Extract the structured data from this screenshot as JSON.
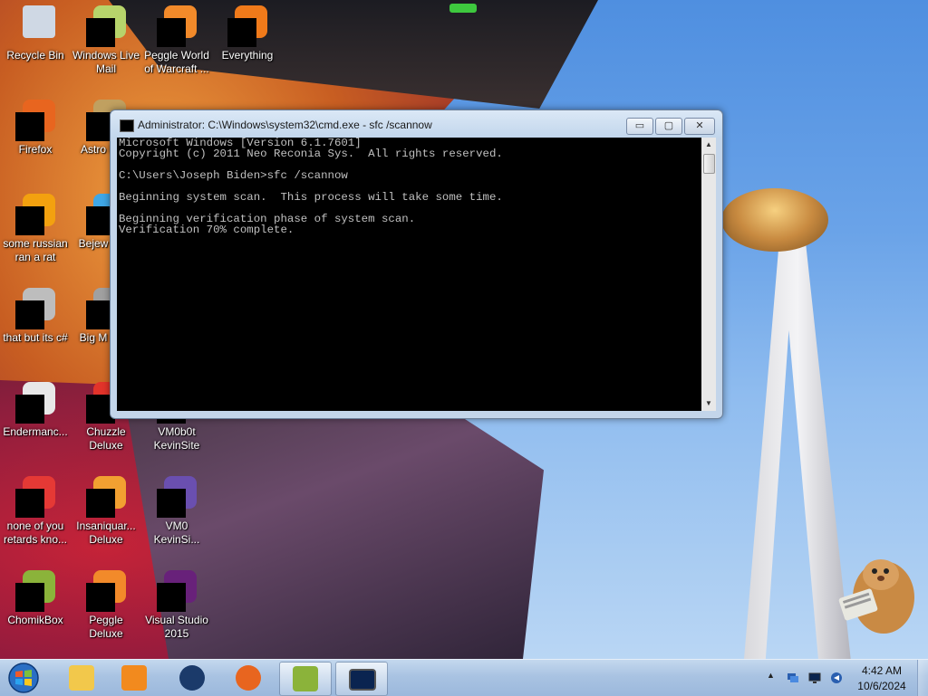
{
  "desktop": {
    "icons": [
      {
        "label": "Recycle Bin",
        "icon": "recycle-bin-icon",
        "color": "#cfd8e4"
      },
      {
        "label": "Windows Live Mail",
        "icon": "mail-icon",
        "color": "#b7d46b"
      },
      {
        "label": "Peggle World of Warcraft ...",
        "icon": "peggle-icon",
        "color": "#f28a2a"
      },
      {
        "label": "Everything",
        "icon": "search-icon",
        "color": "#f07a1a"
      },
      {
        "label": "Firefox",
        "icon": "firefox-icon",
        "color": "#e8651f"
      },
      {
        "label": "Astro Delu",
        "icon": "game-icon",
        "color": "#c0a060"
      },
      {
        "label": "some russian ran a rat",
        "icon": "ie-icon",
        "color": "#f3a10f"
      },
      {
        "label": "Bejew Delu",
        "icon": "gem-icon",
        "color": "#3fa7e6"
      },
      {
        "label": "that but its c#",
        "icon": "window-stack-icon",
        "color": "#bdbdbd"
      },
      {
        "label": "Big M Delu",
        "icon": "game-icon",
        "color": "#a0a0a0"
      },
      {
        "label": "Endermanc...",
        "icon": "window-icon",
        "color": "#e8e8e8"
      },
      {
        "label": "Chuzzle Deluxe",
        "icon": "chuzzle-icon",
        "color": "#e2332a"
      },
      {
        "label": "VM0b0t KevinSite",
        "icon": "vm-icon",
        "color": "#888888"
      },
      {
        "label": "none of you retards kno...",
        "icon": "chrome-icon",
        "color": "#e53935"
      },
      {
        "label": "Insaniquar... Deluxe",
        "icon": "fish-icon",
        "color": "#f2a031"
      },
      {
        "label": "VM0 KevinSi...",
        "icon": "vm-icon",
        "color": "#6a4fb0"
      },
      {
        "label": "ChomikBox",
        "icon": "hamster-icon",
        "color": "#8bb33a"
      },
      {
        "label": "Peggle Deluxe",
        "icon": "peggle-icon",
        "color": "#f28a2a"
      },
      {
        "label": "Visual Studio 2015",
        "icon": "visual-studio-icon",
        "color": "#68217a"
      }
    ]
  },
  "cmd_window": {
    "title": "Administrator: C:\\Windows\\system32\\cmd.exe - sfc  /scannow",
    "lines": [
      "Microsoft Windows [Version 6.1.7601]",
      "Copyright (c) 2011 Neo Reconia Sys.  All rights reserved.",
      "",
      "C:\\Users\\Joseph Biden>sfc /scannow",
      "",
      "Beginning system scan.  This process will take some time.",
      "",
      "Beginning verification phase of system scan.",
      "Verification 70% complete."
    ],
    "minimize_symbol": "▭",
    "maximize_symbol": "▢",
    "close_symbol": "✕",
    "scroll_up_symbol": "▲",
    "scroll_down_symbol": "▼"
  },
  "taskbar": {
    "buttons": [
      {
        "name": "explorer",
        "icon": "folder-icon",
        "color": "#f2c84b"
      },
      {
        "name": "media-player",
        "icon": "media-player-icon",
        "color": "#f28a1e"
      },
      {
        "name": "globe-app",
        "icon": "globe-icon",
        "color": "#1b3a6a"
      },
      {
        "name": "firefox",
        "icon": "firefox-icon",
        "color": "#e8651f"
      },
      {
        "name": "chomikbox",
        "icon": "hamster-icon",
        "color": "#8bb33a"
      },
      {
        "name": "cmd",
        "icon": "console-icon",
        "color": "#0a2450"
      }
    ],
    "clock": {
      "time": "4:42 AM",
      "date": "10/6/2024"
    },
    "tray_expand_symbol": "▲"
  },
  "colors": {
    "console_bg": "#000000",
    "console_fg": "#c0c0c0",
    "accent": "#3ec83e"
  }
}
